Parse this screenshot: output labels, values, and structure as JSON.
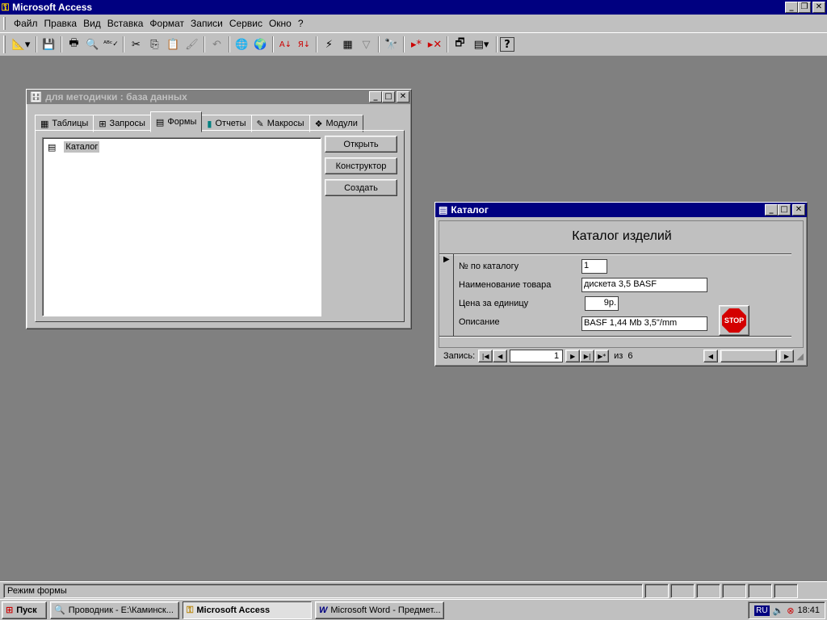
{
  "app": {
    "title": "Microsoft Access",
    "menu": [
      "Файл",
      "Правка",
      "Вид",
      "Вставка",
      "Формат",
      "Записи",
      "Сервис",
      "Окно",
      "?"
    ]
  },
  "toolbar": {
    "icons": [
      "view-icon",
      "save-icon",
      "print-icon",
      "print-preview-icon",
      "spelling-icon",
      "cut-icon",
      "copy-icon",
      "paste-icon",
      "format-painter-icon",
      "undo-icon",
      "web-icon",
      "internet-icon",
      "sort-ascending-icon",
      "sort-descending-icon",
      "filter-by-selection-icon",
      "filter-by-form-icon",
      "apply-filter-icon",
      "find-icon",
      "new-record-icon",
      "delete-record-icon",
      "database-window-icon",
      "new-object-icon",
      "help-icon"
    ]
  },
  "db_window": {
    "title": "для методички : база данных",
    "tabs": [
      {
        "label": "Таблицы",
        "icon": "table-icon"
      },
      {
        "label": "Запросы",
        "icon": "query-icon"
      },
      {
        "label": "Формы",
        "icon": "form-icon"
      },
      {
        "label": "Отчеты",
        "icon": "report-icon"
      },
      {
        "label": "Макросы",
        "icon": "macro-icon"
      },
      {
        "label": "Модули",
        "icon": "module-icon"
      }
    ],
    "selected_tab": "Формы",
    "items": [
      {
        "label": "Каталог"
      }
    ],
    "buttons": {
      "open": "Открыть",
      "design": "Конструктор",
      "create": "Создать"
    }
  },
  "form_window": {
    "title": "Каталог",
    "heading": "Каталог изделий",
    "fields": {
      "catalog_no": {
        "label": "№ по каталогу",
        "value": "1"
      },
      "name": {
        "label": "Наименование товара",
        "value": "дискета 3,5 BASF"
      },
      "price": {
        "label": "Цена за единицу",
        "value": "9р."
      },
      "description": {
        "label": "Описание",
        "value": "BASF 1,44 Mb 3,5\"/mm"
      }
    },
    "stop_button": "STOP",
    "nav": {
      "label": "Запись:",
      "current": "1",
      "of": "из",
      "total": "6"
    }
  },
  "status": {
    "text": "Режим формы"
  },
  "taskbar": {
    "start": "Пуск",
    "buttons": [
      {
        "label": "Проводник - E:\\Каминск..."
      },
      {
        "label": "Microsoft Access"
      },
      {
        "label": "Microsoft Word - Предмет..."
      }
    ],
    "tray": {
      "lang": "RU",
      "time": "18:41"
    }
  },
  "colors": {
    "title_active": "#000080",
    "face": "#c0c0c0",
    "desktop": "#808080",
    "stop": "#d40000"
  }
}
